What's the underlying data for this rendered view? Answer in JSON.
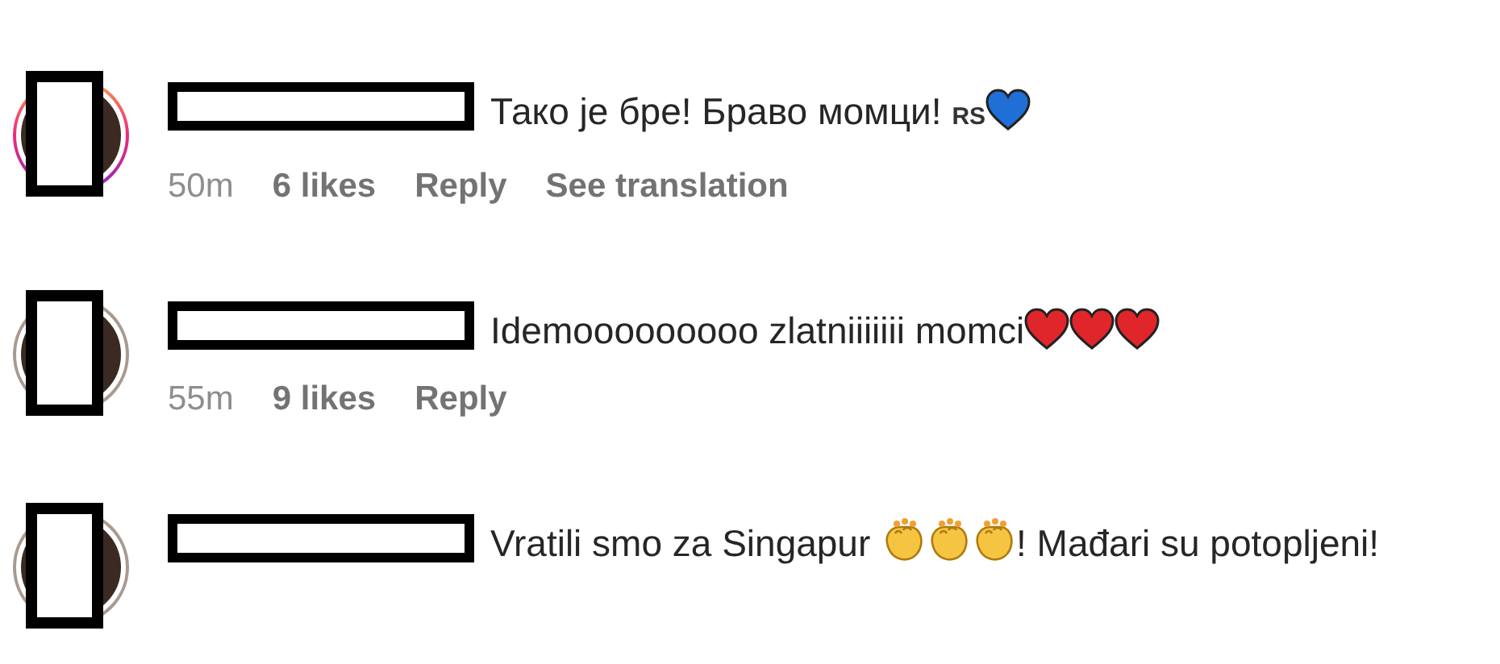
{
  "comments": [
    {
      "avatar": {
        "story_ring": true
      },
      "body": [
        {
          "kind": "text",
          "text": "Тако је бре! Браво момци! "
        },
        {
          "kind": "flag",
          "text": "RS"
        },
        {
          "kind": "heart",
          "color": "#1f6fd6"
        }
      ],
      "meta": [
        {
          "kind": "time",
          "text": "50m"
        },
        {
          "kind": "action",
          "text": "6 likes"
        },
        {
          "kind": "action",
          "text": "Reply"
        },
        {
          "kind": "action",
          "text": "See translation"
        }
      ]
    },
    {
      "avatar": {
        "story_ring": false
      },
      "body": [
        {
          "kind": "text",
          "text": "Idemooooooooo zlatniiiiiii momci"
        },
        {
          "kind": "heart",
          "color": "#e0262b"
        },
        {
          "kind": "heart",
          "color": "#e0262b"
        },
        {
          "kind": "heart",
          "color": "#e0262b"
        }
      ],
      "meta": [
        {
          "kind": "time",
          "text": "55m"
        },
        {
          "kind": "action",
          "text": "9 likes"
        },
        {
          "kind": "action",
          "text": "Reply"
        }
      ]
    },
    {
      "avatar": {
        "story_ring": false
      },
      "body": [
        {
          "kind": "text",
          "text": "Vratili smo za Singapur "
        },
        {
          "kind": "clap"
        },
        {
          "kind": "clap"
        },
        {
          "kind": "clap"
        },
        {
          "kind": "text",
          "text": "! Mađari su potopljeni!"
        }
      ]
    }
  ]
}
